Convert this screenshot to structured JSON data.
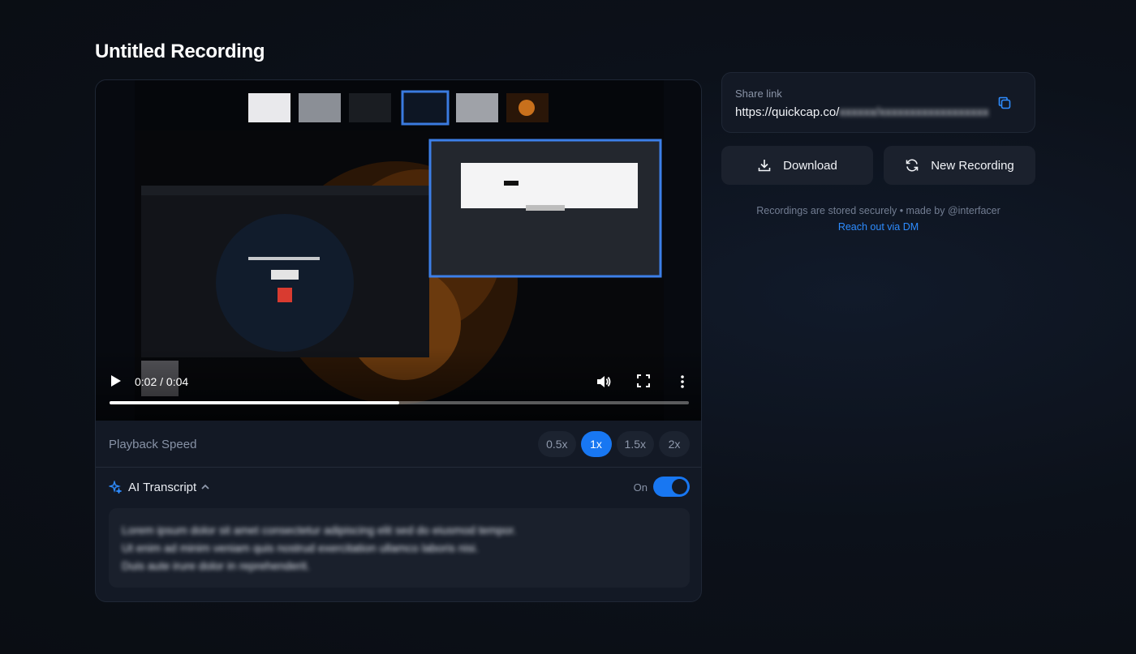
{
  "page": {
    "title": "Untitled Recording"
  },
  "player": {
    "current_time": "0:02",
    "duration": "0:04",
    "time_display": "0:02 / 0:04",
    "progress_fraction": 0.5
  },
  "playback_speed": {
    "label": "Playback Speed",
    "options": [
      "0.5x",
      "1x",
      "1.5x",
      "2x"
    ],
    "selected": "1x"
  },
  "transcript": {
    "title": "AI Transcript",
    "toggle_label": "On",
    "enabled": true,
    "text": "Lorem ipsum dolor sit amet consectetur adipiscing elit sed do eiusmod tempor.\nUt enim ad minim veniam quis nostrud exercitation ullamco laboris nisi.\nDuis aute irure dolor in reprehenderit."
  },
  "share": {
    "label": "Share link",
    "url_visible": "https://quickcap.co/",
    "url_hidden": "xxxxxx/xxxxxxxxxxxxxxxxxx"
  },
  "actions": {
    "download_label": "Download",
    "new_recording_label": "New Recording"
  },
  "footer": {
    "note": "Recordings are stored securely • made by @interfacer",
    "link": "Reach out via DM"
  },
  "colors": {
    "accent": "#1877f2",
    "link": "#2e8cff",
    "background": "#0b0f16",
    "card": "#131925"
  },
  "icons": [
    "play-icon",
    "volume-icon",
    "fullscreen-icon",
    "more-vertical-icon",
    "sparkle-icon",
    "chevron-up-icon",
    "copy-icon",
    "download-icon",
    "refresh-icon"
  ]
}
